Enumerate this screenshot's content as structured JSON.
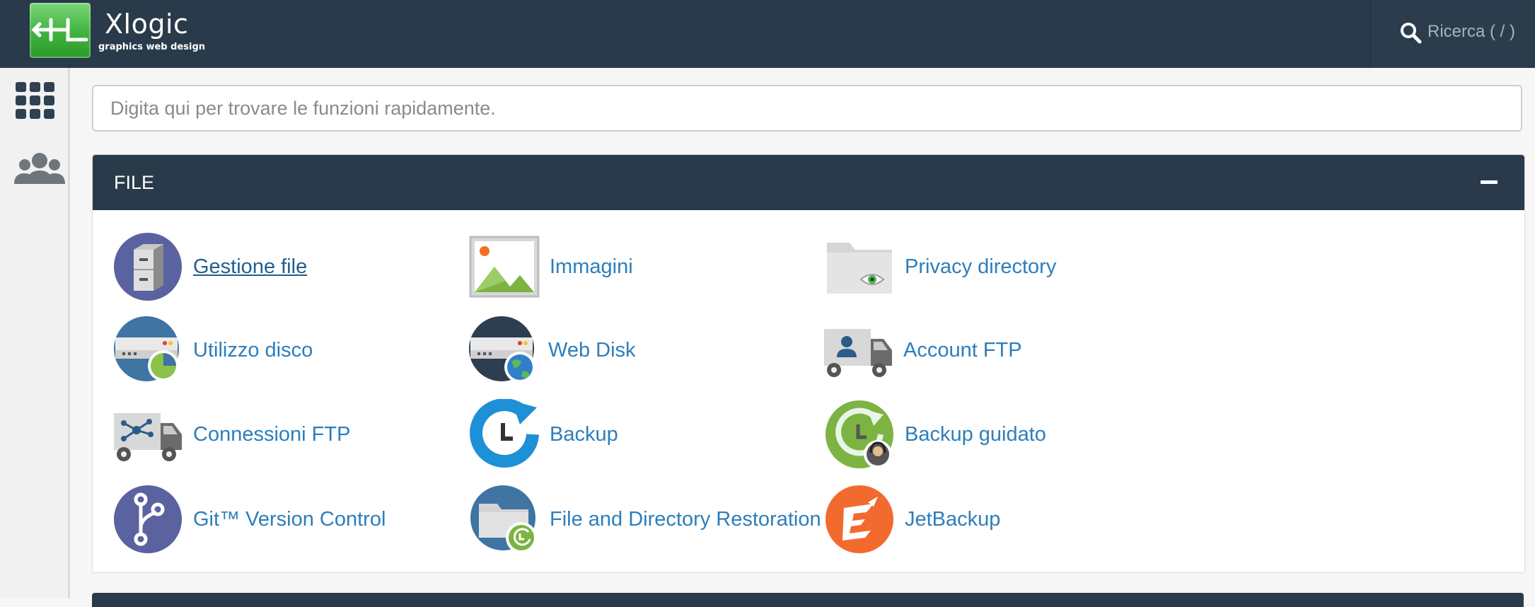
{
  "header": {
    "brand_name": "Xlogic",
    "brand_tagline": "graphics web design",
    "search_label": "Ricerca ( / )"
  },
  "quick_search": {
    "placeholder": "Digita qui per trovare le funzioni rapidamente."
  },
  "section": {
    "title": "FILE",
    "items": [
      {
        "label": "Gestione file",
        "icon": "file-cabinet-icon"
      },
      {
        "label": "Immagini",
        "icon": "image-icon"
      },
      {
        "label": "Privacy directory",
        "icon": "folder-eye-icon"
      },
      {
        "label": "Utilizzo disco",
        "icon": "disk-usage-icon"
      },
      {
        "label": "Web Disk",
        "icon": "web-disk-icon"
      },
      {
        "label": "Account FTP",
        "icon": "ftp-account-truck-icon"
      },
      {
        "label": "Connessioni FTP",
        "icon": "ftp-connections-truck-icon"
      },
      {
        "label": "Backup",
        "icon": "backup-icon"
      },
      {
        "label": "Backup guidato",
        "icon": "backup-wizard-icon"
      },
      {
        "label": "Git™ Version Control",
        "icon": "git-icon"
      },
      {
        "label": "File and Directory Restoration",
        "icon": "folder-restore-icon"
      },
      {
        "label": "JetBackup",
        "icon": "jetbackup-icon"
      }
    ]
  },
  "colors": {
    "topbar": "#293a4a",
    "link": "#2d7ebb",
    "accent_green": "#3fb23e",
    "jetbackup_orange": "#f26a2e"
  }
}
